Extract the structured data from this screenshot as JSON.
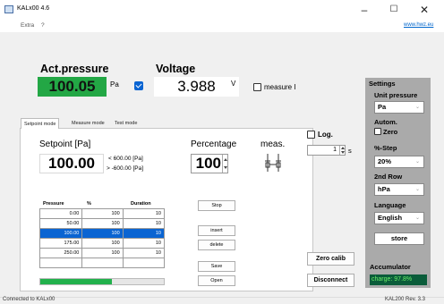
{
  "window": {
    "title": "KALx00 4.6",
    "menu": [
      "Extra",
      "?"
    ],
    "link": "www.hwz.eu",
    "controls": {
      "minimize": "–",
      "maximize": "☐",
      "close": "✕"
    }
  },
  "readouts": {
    "pressure_label": "Act.pressure",
    "pressure_value": "100.05",
    "pressure_unit": "Pa",
    "voltage_label": "Voltage",
    "voltage_value": "3.988",
    "voltage_unit": "V",
    "measure_label": "measure I"
  },
  "tabs": [
    "Setpoint mode",
    "Measure mode",
    "Test mode"
  ],
  "setpoint": {
    "label": "Setpoint [Pa]",
    "value": "100.00",
    "limit_max": "< 600.00 [Pa]",
    "limit_min": "> -600.00 [Pa]",
    "percentage_label": "Percentage",
    "percentage_value": "100",
    "meas_label": "meas."
  },
  "log": {
    "label": "Log.",
    "value": "1",
    "unit": "s"
  },
  "table": {
    "columns": [
      "Pressure",
      "%",
      "Duration"
    ],
    "rows": [
      [
        "0.00",
        "100",
        "10"
      ],
      [
        "50.00",
        "100",
        "10"
      ],
      [
        "100.00",
        "100",
        "10"
      ],
      [
        "175.00",
        "100",
        "10"
      ],
      [
        "250.00",
        "100",
        "10"
      ]
    ],
    "selected_row": 2
  },
  "progress": {
    "fraction": 0.58
  },
  "buttons": {
    "stop": "Stop",
    "insert": "insert",
    "delete": "delete",
    "save": "Save",
    "open": "Open",
    "zero_calib": "Zero calib",
    "disconnect": "Disconnect"
  },
  "settings": {
    "title": "Settings",
    "unit_pressure_label": "Unit pressure",
    "unit_pressure_value": "Pa",
    "autom_label": "Autom.",
    "zero_label": "Zero",
    "step_label": "%-Step",
    "step_value": "20%",
    "second_row_label": "2nd Row",
    "second_row_value": "hPa",
    "language_label": "Language",
    "language_value": "English",
    "store_label": "store",
    "accumulator_label": "Accumulator",
    "charge": "charge: 97.8%"
  },
  "status": {
    "left": "Connected to KALx00",
    "right": "KAL200 Rev. 3.3"
  },
  "colors": {
    "pressure_bg": "#23a745",
    "selection": "#0a64d2",
    "settings_bg": "#aaaaaa",
    "charge_bg": "#0a5c3a",
    "charge_text": "#6cf06a",
    "progress": "#22b14c"
  }
}
